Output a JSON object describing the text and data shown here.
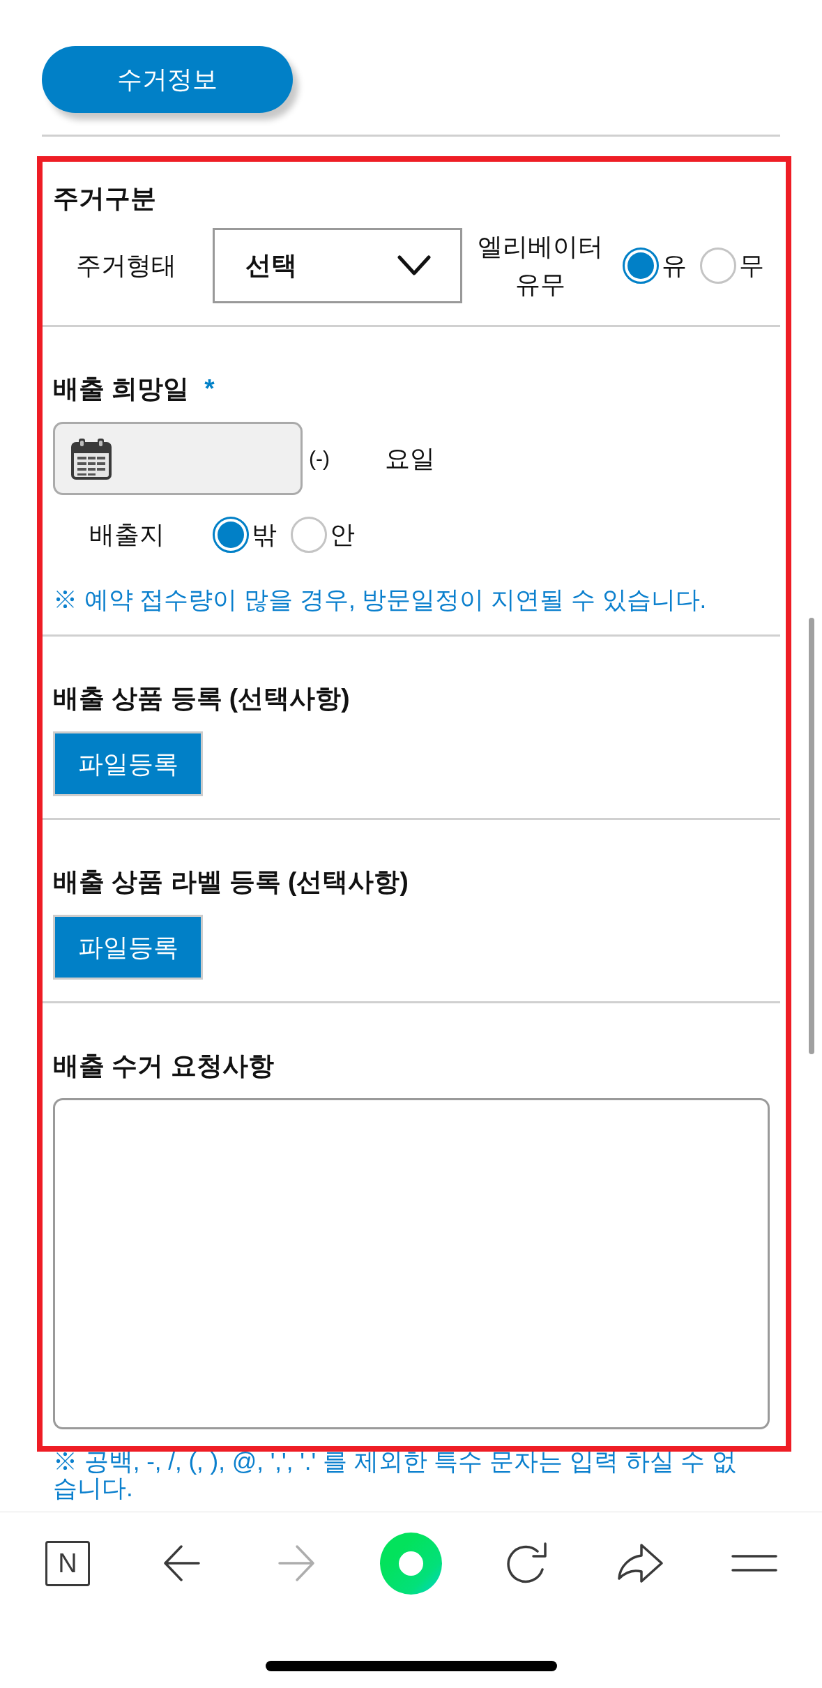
{
  "section_button": {
    "label": "수거정보"
  },
  "residence": {
    "title": "주거구분",
    "type_label": "주거형태",
    "type_select": {
      "value": "선택"
    },
    "elevator_label": "엘리베이터 유무",
    "elevator_options": [
      {
        "label": "유",
        "selected": true
      },
      {
        "label": "무",
        "selected": false
      }
    ]
  },
  "pickup_date": {
    "title": "배출 희망일",
    "required_mark": "*",
    "weekday_value": "(-)",
    "weekday_label": "요일",
    "location_label": "배출지",
    "location_options": [
      {
        "label": "밖",
        "selected": true
      },
      {
        "label": "안",
        "selected": false
      }
    ],
    "notice": "※ 예약 접수량이 많을 경우, 방문일정이 지연될 수 있습니다."
  },
  "uploads": [
    {
      "title": "배출 상품 등록 (선택사항)",
      "button": "파일등록"
    },
    {
      "title": "배출 상품 라벨 등록 (선택사항)",
      "button": "파일등록"
    }
  ],
  "request": {
    "title": "배출 수거 요청사항",
    "notice": "※ 공백, -, /, (, ), @, ',', '.' 를 제외한 특수 문자는 입력 하실 수 없습니다."
  },
  "browser_toolbar": {
    "home_logo": "N",
    "back": {
      "disabled": false
    },
    "forward": {
      "disabled": true
    }
  }
}
